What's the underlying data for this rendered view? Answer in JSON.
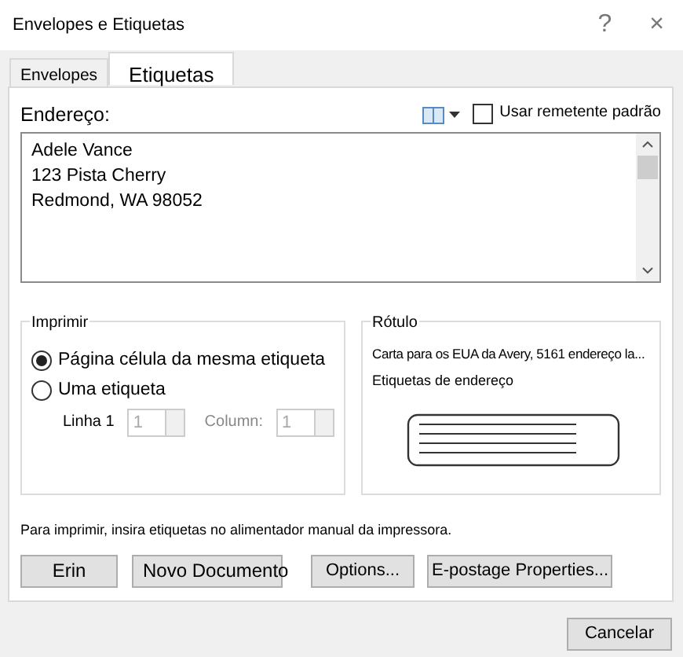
{
  "window": {
    "title": "Envelopes e Etiquetas",
    "help": "?",
    "close": "×"
  },
  "tabs": [
    {
      "label": "Envelopes",
      "selected": false
    },
    {
      "label": "Etiquetas",
      "selected": true
    }
  ],
  "address": {
    "label": "Endereço:",
    "use_default_sender": {
      "label": "Usar remetente padrão",
      "checked": false
    },
    "lines": [
      "Adele Vance",
      "123 Pista Cherry",
      "Redmond, WA 98052"
    ]
  },
  "print_group": {
    "title": "Imprimir",
    "options": [
      {
        "label": "Página célula da mesma etiqueta",
        "selected": true
      },
      {
        "label": "Uma etiqueta",
        "selected": false
      }
    ],
    "row_label": "Linha 1",
    "row_value": "1",
    "column_label": "Column:",
    "column_value": "1",
    "spinners_disabled": true
  },
  "label_group": {
    "title": "Rótulo",
    "description": "Carta para os EUA da Avery, 5161 endereço la...",
    "type": "Etiquetas de endereço"
  },
  "note": "Para imprimir, insira etiquetas no alimentador manual da impressora.",
  "buttons": [
    "Erin",
    "Novo Documento",
    "Options...",
    "E-postage Properties..."
  ],
  "cancel": "Cancelar"
}
